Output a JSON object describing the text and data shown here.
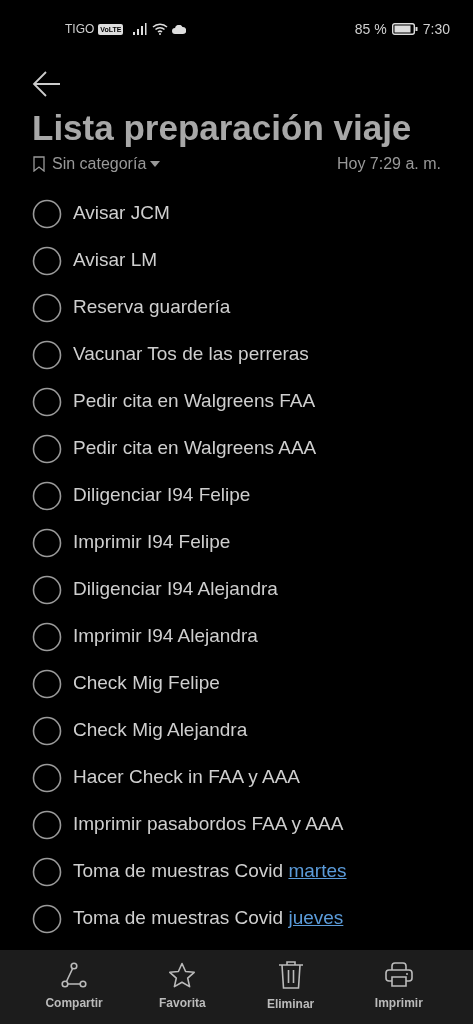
{
  "status_bar": {
    "carrier": "TIGO",
    "volte": "VoLTE",
    "battery": "85 %",
    "time": "7:30"
  },
  "title": "Lista preparación viaje",
  "category": "Sin categoría",
  "modified": "Hoy 7:29 a. m.",
  "items": [
    {
      "text": "Avisar JCM",
      "checked": false
    },
    {
      "text": "Avisar LM",
      "checked": false
    },
    {
      "text": "Reserva guardería",
      "checked": false
    },
    {
      "text": "Vacunar Tos de las perreras",
      "checked": false
    },
    {
      "text": "Pedir cita en Walgreens FAA",
      "checked": false
    },
    {
      "text": "Pedir cita en Walgreens AAA",
      "checked": false
    },
    {
      "text": "Diligenciar I94 Felipe",
      "checked": false
    },
    {
      "text": "Imprimir I94 Felipe",
      "checked": false
    },
    {
      "text": "Diligenciar I94 Alejandra",
      "checked": false
    },
    {
      "text": "Imprimir I94 Alejandra",
      "checked": false
    },
    {
      "text": "Check Mig Felipe",
      "checked": false
    },
    {
      "text": "Check Mig Alejandra",
      "checked": false
    },
    {
      "text": "Hacer Check in FAA y AAA",
      "checked": false
    },
    {
      "text": "Imprimir pasabordos FAA y AAA",
      "checked": false
    },
    {
      "text": "Toma de muestras Covid",
      "link": "martes",
      "checked": false
    },
    {
      "text": "Toma de muestras Covid",
      "link": "jueves",
      "checked": false
    }
  ],
  "toolbar": [
    {
      "kind": "share",
      "label": "Compartir"
    },
    {
      "kind": "star",
      "label": "Favorita"
    },
    {
      "kind": "trash",
      "label": "Eliminar"
    },
    {
      "kind": "print",
      "label": "Imprimir"
    }
  ]
}
